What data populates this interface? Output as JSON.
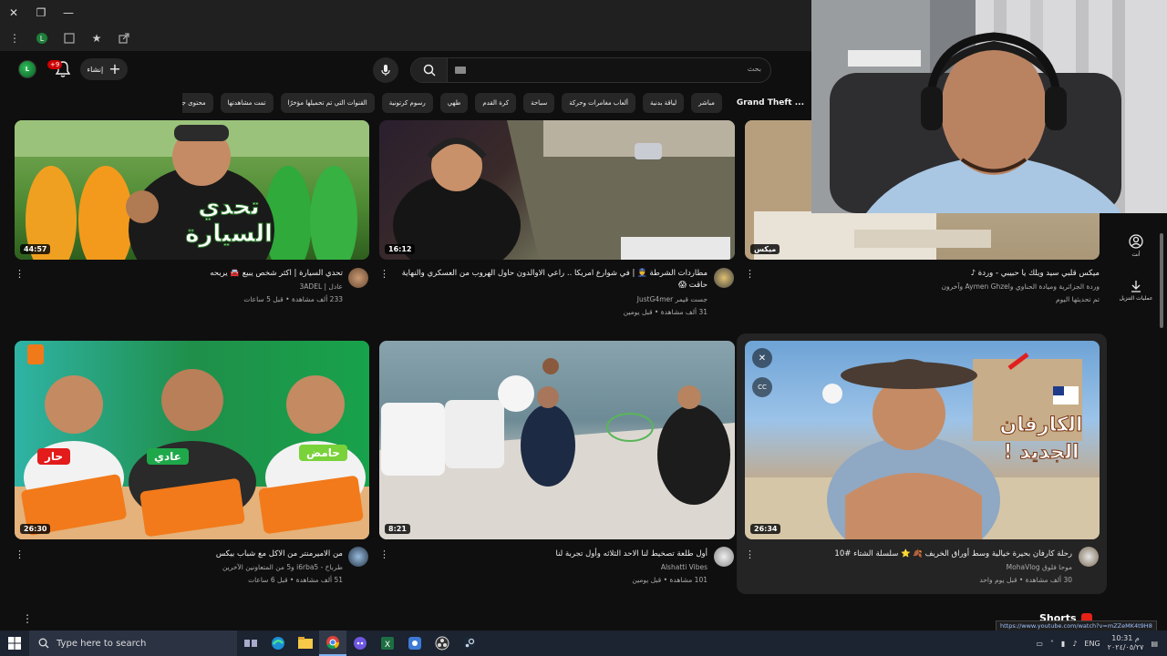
{
  "browser": {
    "controls": {
      "close": "✕",
      "restore": "❐",
      "minimize": "—"
    }
  },
  "header": {
    "create_label": "إنشاء",
    "notification_count": "+9",
    "search_placeholder": "بحث"
  },
  "chips": [
    "Grand Theft ...",
    "مباشر",
    "لياقة بدنية",
    "ألعاب مغامرات وحركة",
    "سباحة",
    "كرة القدم",
    "طهي",
    "رسوم كرتونية",
    "القنوات التي تم تحميلها مؤخرًا",
    "تمت مشاهدتها",
    "محتوى جديد لك"
  ],
  "videos": [
    {
      "title": "تحدي السيارة | اكثر شخص يبيع 🚘 يربحه",
      "channel": "عادل | 3ADEL",
      "meta": "233 ألف مشاهدة • قبل 5 ساعات",
      "duration": "44:57",
      "thumb_text": "تحدي السيارة"
    },
    {
      "title": "مطاردات الشرطة 👮 | في شوارع امريكا .. راعي الاوالدون حاول الهروب من العسكري والنهاية حاقت 😱",
      "channel": "جست قيمر JustG4mer",
      "meta": "31 ألف مشاهدة • قبل يومين",
      "duration": "16:12"
    },
    {
      "title": "ميكس قلبي سيد ويلك يا حبيبي - وردة ♪",
      "channel": "وردة الجزائرية وميادة الحناوي وAymen Ghzel وآخرون",
      "meta": "تم تحديثها اليوم",
      "badge": "ميكس"
    },
    {
      "title": "من الاميرمنتر من الاكل مع شباب بيكس",
      "channel": "طرباخ - i6rba5 و5 من المتعاونين الآخرين",
      "meta": "51 ألف مشاهدة • قبل 6 ساعات",
      "duration": "26:30",
      "thumb_labels": [
        "حار",
        "عادي",
        "حامض"
      ]
    },
    {
      "title": "أول طلعة تصخيط لنا الاحد الثلاثه وأول تجربة لنا",
      "channel": "Alshatti Vibes",
      "meta": "101 مشاهدة • قبل يومين",
      "duration": "8:21"
    },
    {
      "title": "رحلة كارفان بحيرة خيالية وسط أوراق الخريف 🍂 ⭐ سلسلة الشتاء #10",
      "channel": "موحا فلوق MohaVlog",
      "meta": "30 ألف مشاهدة • قبل يوم واحد",
      "duration": "26:34",
      "thumb_text": "الكارفان الجديد !"
    }
  ],
  "sidebar": {
    "you_label": "أنت",
    "downloads_label": "عمليات التنزيل"
  },
  "shorts_label": "Shorts",
  "url_hint": "https://www.youtube.com/watch?v=mZZeMK4t9H8",
  "taskbar": {
    "search_placeholder": "Type here to search",
    "language": "ENG",
    "time": "10:31 م",
    "date": "٢٠٢٤/٠٥/٢٧"
  },
  "colors": {
    "background": "#0f0f0f",
    "accent_red": "#cc0000",
    "taskbar": "#1c2331"
  }
}
